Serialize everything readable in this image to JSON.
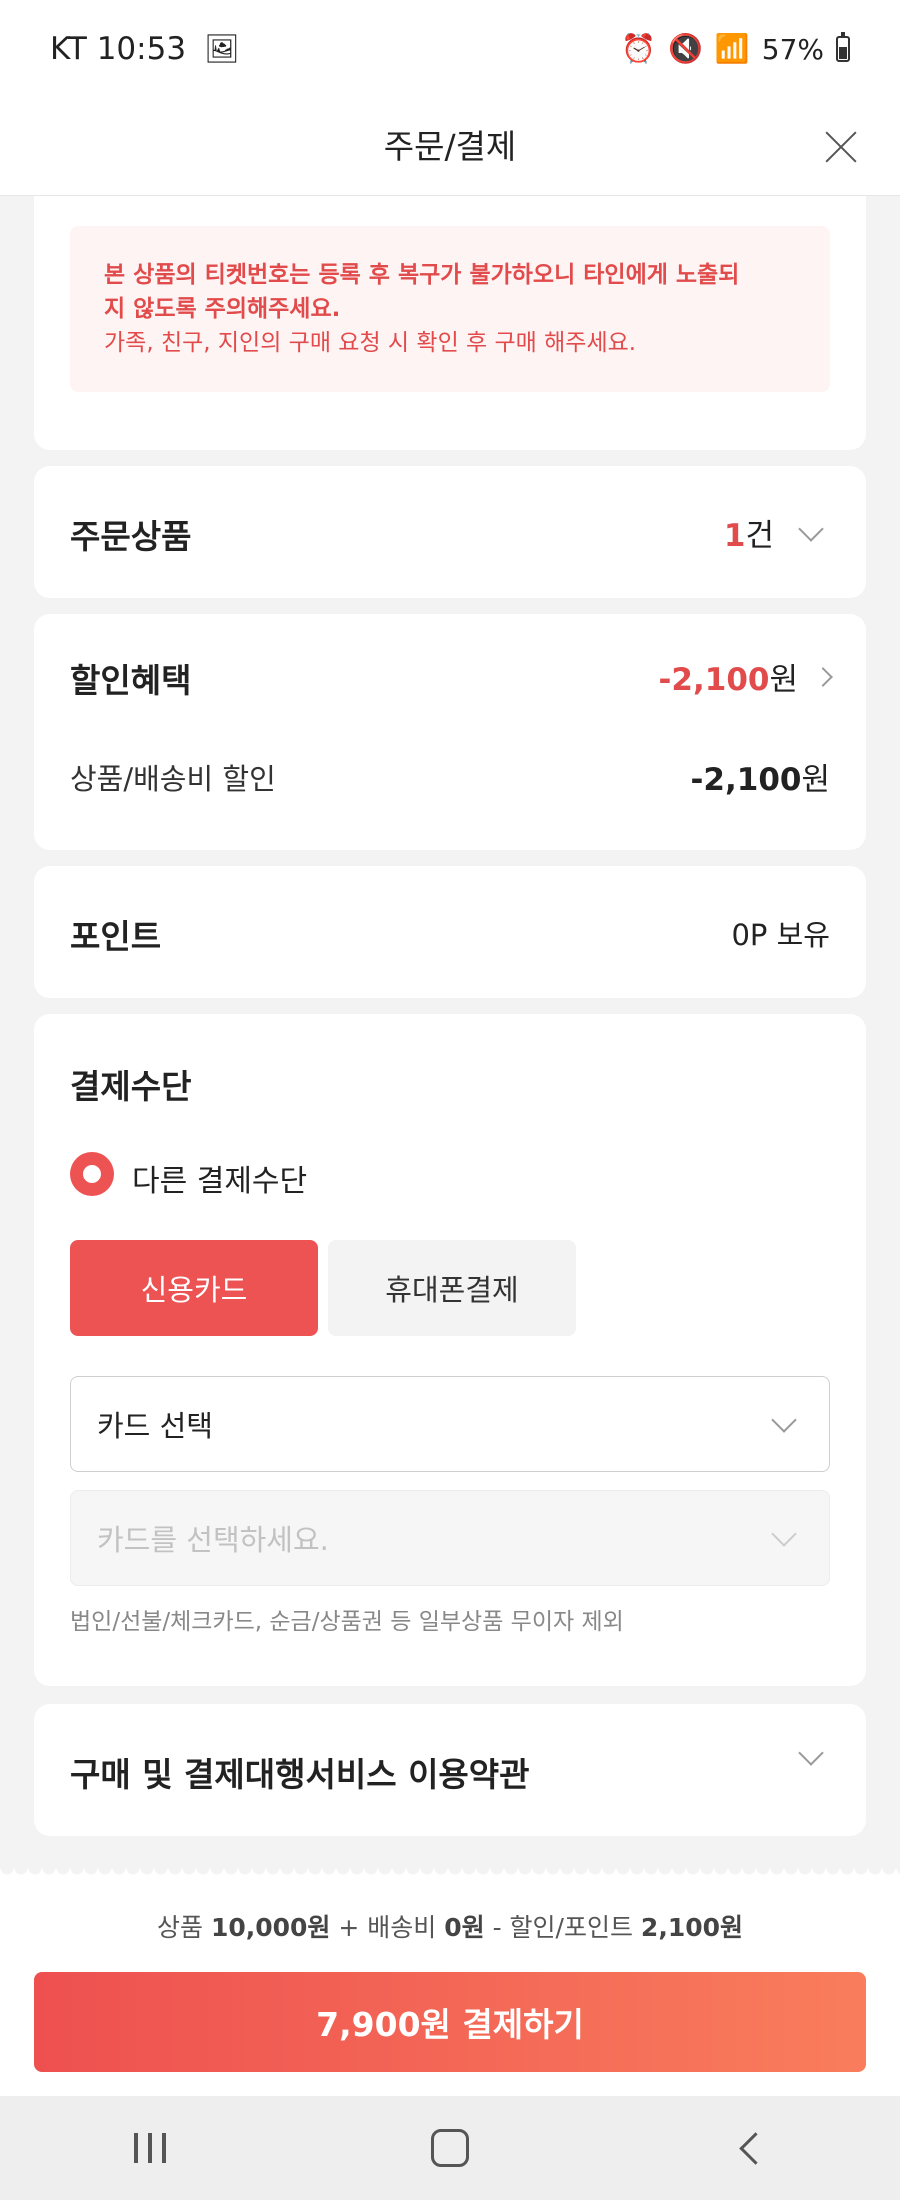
{
  "status": {
    "carrier_time": "KT 10:53",
    "battery": "57%"
  },
  "header": {
    "title": "주문/결제"
  },
  "notice": {
    "line1": "본 상품의 티켓번호는 등록 후 복구가 불가하오니 타인에게 노출되",
    "line2": "지 않도록 주의해주세요.",
    "line3": "가족, 친구, 지인의 구매 요청 시 확인 후 구매 해주세요."
  },
  "order_items": {
    "title": "주문상품",
    "count": "1",
    "count_unit": "건"
  },
  "discount": {
    "title": "할인혜택",
    "total": "-2,100",
    "total_unit": "원",
    "row_label": "상품/배송비 할인",
    "row_value": "-2,100",
    "row_unit": "원"
  },
  "points": {
    "title": "포인트",
    "value": "0P 보유"
  },
  "payment": {
    "title": "결제수단",
    "option_label": "다른 결제수단",
    "methods": [
      "신용카드",
      "휴대폰결제"
    ],
    "card_select": "카드 선택",
    "card_placeholder": "카드를 선택하세요.",
    "note": "법인/선불/체크카드, 순금/상품권 등 일부상품 무이자 제외"
  },
  "terms": {
    "title": "구매 및 결제대행서비스 이용약관"
  },
  "summary": {
    "p1": "상품 ",
    "product": "10,000원",
    "p2": " + 배송비 ",
    "shipping": "0원",
    "p3": " - 할인/포인트 ",
    "discount": "2,100원"
  },
  "pay_button": "7,900원 결제하기",
  "colors": {
    "accent": "#ee5353",
    "gradient_end": "#f97d5c",
    "notice_bg": "#fff4f4"
  }
}
